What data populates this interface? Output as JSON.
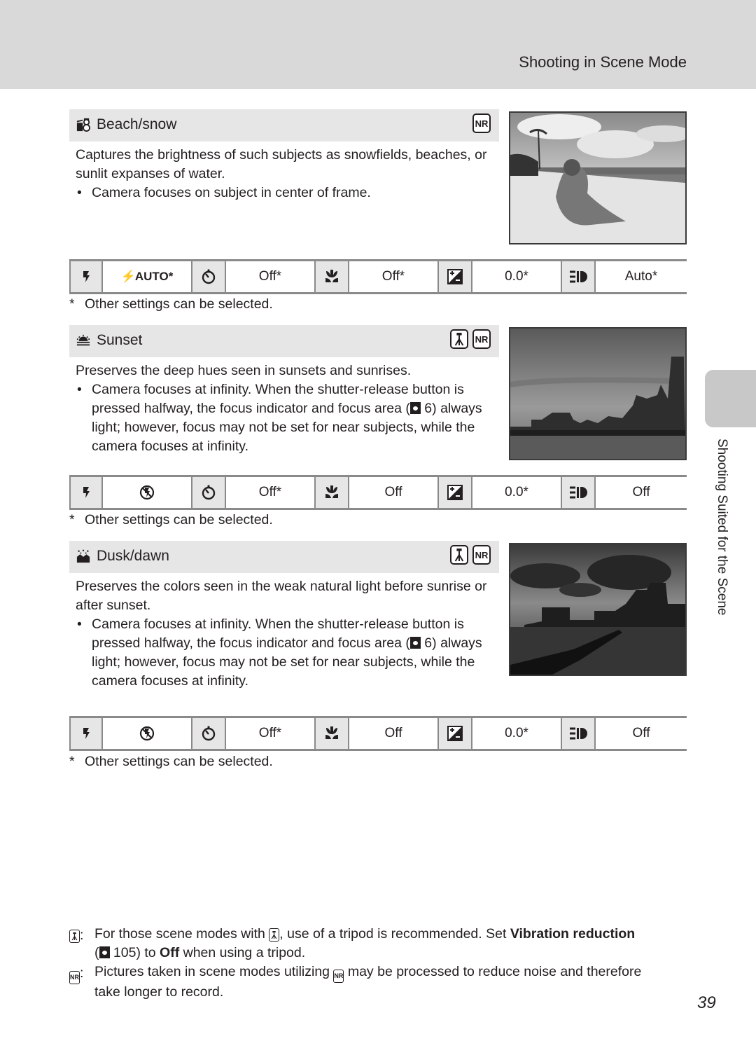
{
  "header": {
    "title": "Shooting in Scene Mode"
  },
  "side_tab": {
    "label": "Shooting Suited for the Scene"
  },
  "scenes": [
    {
      "icon": "beach-snow-icon",
      "title": "Beach/snow",
      "badges": [
        "NR"
      ],
      "description": "Captures the brightness of such subjects as snowfields, beaches, or sunlit expanses of water.",
      "bullets": [
        "Camera focuses on subject in center of frame."
      ],
      "settings": {
        "flash": "AUTO*",
        "self_timer": "Off*",
        "macro": "Off*",
        "exposure_comp": "0.0*",
        "vibration": "Auto*"
      },
      "note": "Other settings can be selected."
    },
    {
      "icon": "sunset-icon",
      "title": "Sunset",
      "badges": [
        "tripod",
        "NR"
      ],
      "description": "Preserves the deep hues seen in sunsets and sunrises.",
      "bullets": [
        "Camera focuses at infinity. When the shutter-release button is pressed halfway, the focus indicator and focus area (",
        " 6) always light; however, focus may not be set for near subjects, while the camera focuses at infinity."
      ],
      "settings": {
        "flash": "flash-off",
        "self_timer": "Off*",
        "macro": "Off",
        "exposure_comp": "0.0*",
        "vibration": "Off"
      },
      "note": "Other settings can be selected."
    },
    {
      "icon": "dusk-dawn-icon",
      "title": "Dusk/dawn",
      "badges": [
        "tripod",
        "NR"
      ],
      "description": "Preserves the colors seen in the weak natural light before sunrise or after sunset.",
      "bullets": [
        "Camera focuses at infinity. When the shutter-release button is pressed halfway, the focus indicator and focus area (",
        " 6) always light; however, focus may not be set for near subjects, while the camera focuses at infinity."
      ],
      "settings": {
        "flash": "flash-off",
        "self_timer": "Off*",
        "macro": "Off",
        "exposure_comp": "0.0*",
        "vibration": "Off"
      },
      "note": "Other settings can be selected."
    }
  ],
  "note_star": "*",
  "footer": {
    "tripod_note": {
      "a": "For those scene modes with ",
      "b": ", use of a tripod is recommended. Set ",
      "bold1": "Vibration reduction",
      "c": " (",
      "d": " 105) to ",
      "bold2": "Off",
      "e": " when using a tripod."
    },
    "nr_note": {
      "a": "Pictures taken in scene modes utilizing ",
      "b": " may be processed to reduce noise and therefore take longer to record."
    }
  },
  "badge_nr_text": "NR",
  "page_number": "39"
}
